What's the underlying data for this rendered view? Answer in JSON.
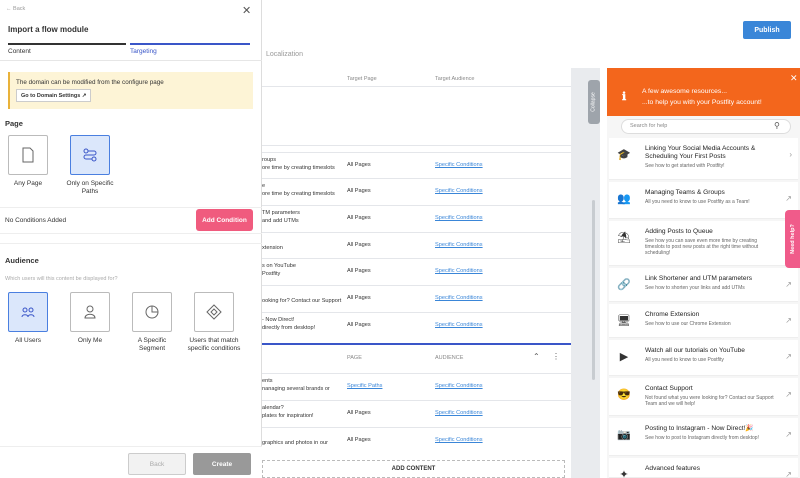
{
  "background": {
    "publish_label": "Publish",
    "localization_tab": "Localization",
    "table1_headers": {
      "page": "Target Page",
      "audience": "Target Audience"
    },
    "table1_rows": [
      {
        "title": "roups",
        "desc": "ore time by creating timeslots",
        "desc2": "time without scheduling!",
        "page": "All Pages",
        "audience": "Specific Conditions"
      },
      {
        "title": "e",
        "desc": "ore time by creating timeslots",
        "desc2": "time without scheduling!",
        "page": "All Pages",
        "audience": "Specific Conditions"
      },
      {
        "title": "TM parameters",
        "desc": "and add UTMs",
        "desc2": "",
        "page": "All Pages",
        "audience": "Specific Conditions"
      },
      {
        "title": "",
        "desc": "xtension",
        "desc2": "",
        "page": "All Pages",
        "audience": "Specific Conditions"
      },
      {
        "title": "s on YouTube",
        "desc": "Postfity",
        "desc2": "",
        "page": "All Pages",
        "audience": "Specific Conditions"
      },
      {
        "title": "",
        "desc": "ooking for? Contact our Support",
        "desc2": "",
        "page": "All Pages",
        "audience": "Specific Conditions"
      },
      {
        "title": "- Now Direct!",
        "desc": "directly from desktop!",
        "desc2": "",
        "page": "All Pages",
        "audience": "Specific Conditions"
      }
    ],
    "table2_headers": {
      "page": "PAGE",
      "audience": "AUDIENCE"
    },
    "table2_rows": [
      {
        "title": "ents",
        "desc": "nanaging several brands or",
        "page": "Specific Paths",
        "audience": "Specific Conditions"
      },
      {
        "title": "alendar?",
        "desc": "plates for inspiration!",
        "page": "All Pages",
        "audience": "Specific Conditions"
      },
      {
        "title": "",
        "desc": "graphics and photos in our",
        "page": "All Pages",
        "audience": "Specific Conditions"
      }
    ],
    "add_content": "ADD CONTENT",
    "collapse": "Collapse"
  },
  "help_panel": {
    "heading": "A few awesome resources...",
    "subheading": "...to help you with your Postfity account!",
    "search_placeholder": "Search for help",
    "need_help": "Need help?",
    "items": [
      {
        "icon": "graduate-icon",
        "glyph": "🎓",
        "title": "Linking Your Social Media Accounts & Scheduling Your First Posts",
        "desc": "See how to get started with Postfity!"
      },
      {
        "icon": "team-icon",
        "glyph": "👥",
        "title": "Managing Teams & Groups",
        "desc": "All you need to know to use Postfity as a Team!"
      },
      {
        "icon": "beach-icon",
        "glyph": "⛱",
        "title": "Adding Posts to Queue",
        "desc": "See how you can save even more time by creating timeslots to post new posts at the right time without scheduling!"
      },
      {
        "icon": "link-icon",
        "glyph": "🔗",
        "title": "Link Shortener and UTM parameters",
        "desc": "See how to shorten your links and add UTMs"
      },
      {
        "icon": "monitor-icon",
        "glyph": "🖥",
        "title": "Chrome Extension",
        "desc": "See how to use our Chrome Extension"
      },
      {
        "icon": "play-icon",
        "glyph": "▶",
        "title": "Watch all our tutorials on YouTube",
        "desc": "All you need to know to use Postfity"
      },
      {
        "icon": "sunglasses-icon",
        "glyph": "😎",
        "title": "Contact Support",
        "desc": "Not found what you were looking for? Contact our Support Team and we will help!"
      },
      {
        "icon": "camera-icon",
        "glyph": "📷",
        "title": "Posting to Instagram - Now Direct!🎉",
        "desc": "See how to post to Instagram directly from desktop!"
      },
      {
        "icon": "sparkle-icon",
        "glyph": "✦",
        "title": "Advanced features",
        "desc": ""
      }
    ]
  },
  "modal": {
    "back": "Back",
    "title": "Import a flow module",
    "tabs": [
      "Content",
      "Targeting"
    ],
    "notice": "The domain can be modified from the configure page",
    "domain_button": "Go to Domain Settings",
    "page_section": "Page",
    "page_options": [
      "Any Page",
      "Only on Specific Paths"
    ],
    "no_conditions": "No Conditions Added",
    "add_condition": "Add Condition",
    "audience_section": "Audience",
    "audience_question": "Which users will this content be displayed for?",
    "audience_options": [
      "All Users",
      "Only Me",
      "A Specific Segment",
      "Users that match specific conditions"
    ],
    "back_button": "Back",
    "create_button": "Create"
  },
  "colors": {
    "accent": "#3a86d8",
    "help_orange": "#f3661c",
    "pink": "#f05b7e"
  }
}
